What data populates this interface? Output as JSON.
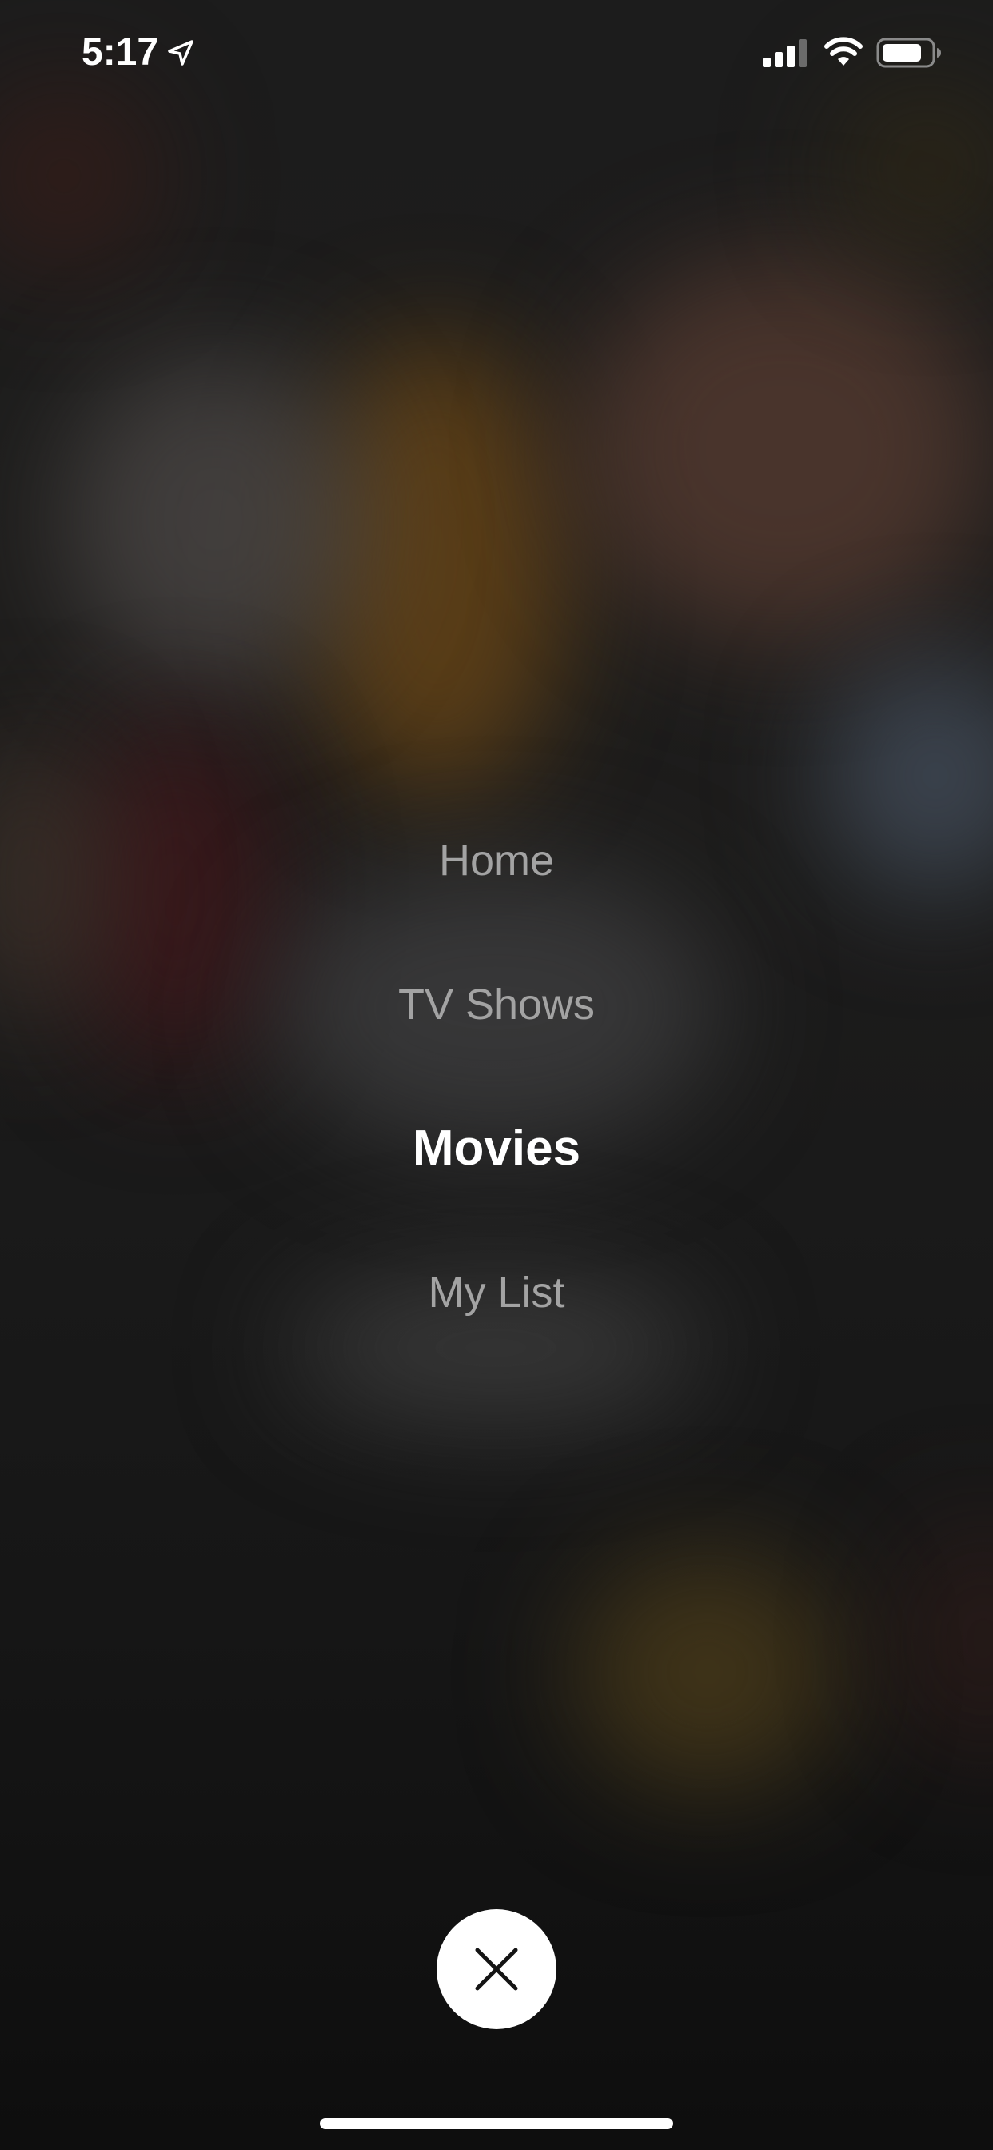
{
  "status_bar": {
    "time": "5:17",
    "icons": [
      "location-arrow-icon",
      "cellular-signal-icon",
      "wifi-icon",
      "battery-icon"
    ]
  },
  "menu": {
    "items": [
      {
        "label": "Home",
        "selected": false
      },
      {
        "label": "TV Shows",
        "selected": false
      },
      {
        "label": "Movies",
        "selected": true
      },
      {
        "label": "My List",
        "selected": false
      }
    ]
  },
  "close_button": {
    "icon": "close-icon"
  },
  "colors": {
    "active_text": "#ffffff",
    "inactive_text": "#a3a3a3",
    "close_button_bg": "#ffffff",
    "close_icon": "#141414"
  }
}
